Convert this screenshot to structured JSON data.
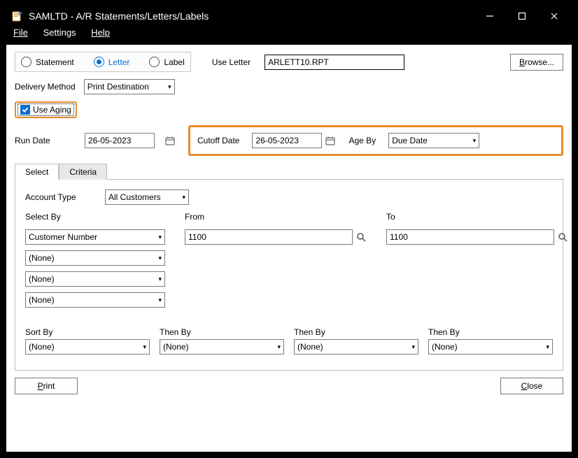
{
  "window": {
    "title": "SAMLTD - A/R Statements/Letters/Labels"
  },
  "menu": {
    "file": "File",
    "settings": "Settings",
    "help": "Help"
  },
  "top": {
    "radio_statement": "Statement",
    "radio_letter": "Letter",
    "radio_label": "Label",
    "use_letter_label": "Use Letter",
    "use_letter_value": "ARLETT10.RPT",
    "browse": "Browse..."
  },
  "delivery": {
    "label": "Delivery Method",
    "value": "Print Destination"
  },
  "aging": {
    "use_aging_label": "Use Aging",
    "run_date_label": "Run Date",
    "run_date_value": "26-05-2023",
    "cutoff_label": "Cutoff Date",
    "cutoff_value": "26-05-2023",
    "age_by_label": "Age By",
    "age_by_value": "Due Date"
  },
  "tabs": {
    "select": "Select",
    "criteria": "Criteria"
  },
  "select_tab": {
    "account_type_label": "Account Type",
    "account_type_value": "All Customers",
    "select_by_label": "Select By",
    "from_label": "From",
    "to_label": "To",
    "select_by_values": [
      "Customer Number",
      "(None)",
      "(None)",
      "(None)"
    ],
    "from_values": [
      "1100"
    ],
    "to_values": [
      "1100"
    ],
    "sort_by_label": "Sort By",
    "then_by_label": "Then By",
    "sort_values": [
      "(None)",
      "(None)",
      "(None)",
      "(None)"
    ]
  },
  "footer": {
    "print": "Print",
    "close": "Close"
  }
}
